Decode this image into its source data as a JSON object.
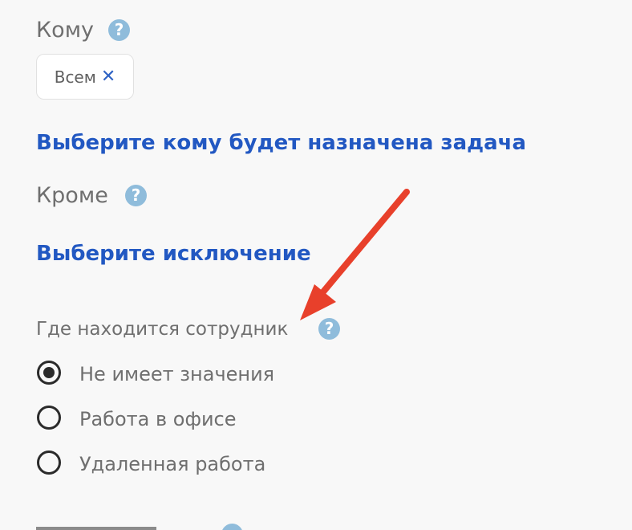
{
  "to_section": {
    "label": "Кому",
    "help_icon": "?",
    "chip": {
      "text": "Всем",
      "remove_icon": "✕"
    },
    "select_link": "Выберите кому будет назначена задача"
  },
  "except_section": {
    "label": "Кроме",
    "help_icon": "?",
    "select_link": "Выберите исключение"
  },
  "location_section": {
    "label": "Где находится сотрудник",
    "help_icon": "?",
    "options": [
      {
        "label": "Не имеет значения",
        "selected": true
      },
      {
        "label": "Работа в офисе",
        "selected": false
      },
      {
        "label": "Удаленная работа",
        "selected": false
      }
    ]
  },
  "annotation": {
    "arrow_color": "#e8402b"
  },
  "colors": {
    "link": "#2258c2",
    "help_icon": "#8fbcdb",
    "background": "#f8f8f8"
  }
}
